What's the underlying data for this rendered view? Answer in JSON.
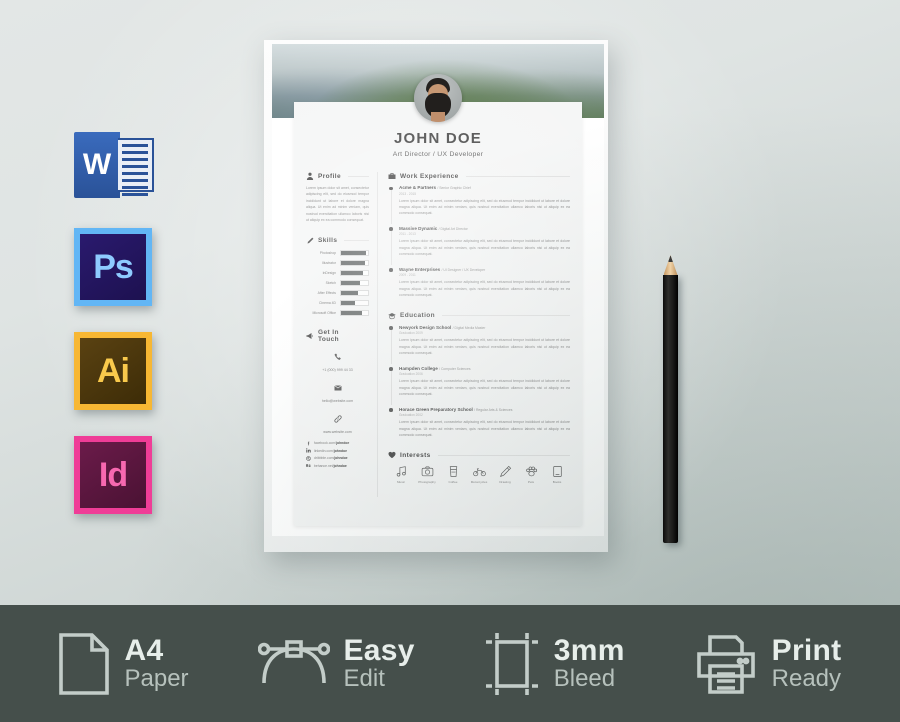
{
  "software_badges": [
    {
      "name": "Microsoft Word",
      "letters": "W",
      "icon": "word-icon"
    },
    {
      "name": "Adobe Photoshop",
      "letters": "Ps",
      "icon": "photoshop-icon"
    },
    {
      "name": "Adobe Illustrator",
      "letters": "Ai",
      "icon": "illustrator-icon"
    },
    {
      "name": "Adobe InDesign",
      "letters": "Id",
      "icon": "indesign-icon"
    }
  ],
  "resume": {
    "name": "JOHN DOE",
    "role": "Art Director / UX Developer",
    "profile": {
      "title": "Profile",
      "icon": "user-icon",
      "text": "Lorem ipsum dolor sit amet, consectetur adipiscing elit, sed do eiusmod tempor incididunt ut labore et dolore magna aliqua. Ut enim ad minim veniam, quis nostrud exercitation ullamco laboris nisi ut aliquip ex ea commodo consequat."
    },
    "skills": {
      "title": "Skills",
      "icon": "pen-icon",
      "items": [
        {
          "label": "Photoshop",
          "value": 92
        },
        {
          "label": "Illustrator",
          "value": 88
        },
        {
          "label": "InDesign",
          "value": 80
        },
        {
          "label": "Sketch",
          "value": 70
        },
        {
          "label": "After Effects",
          "value": 64
        },
        {
          "label": "Cinema 4D",
          "value": 51
        },
        {
          "label": "Microsoft Office",
          "value": 76
        }
      ]
    },
    "contact": {
      "title": "Get In Touch",
      "icon": "megaphone-icon",
      "phone": {
        "icon": "phone-icon",
        "value": "+1 (000) 999 44 33"
      },
      "email": {
        "icon": "mail-icon",
        "value": "hello@website.com"
      },
      "website": {
        "icon": "link-icon",
        "value": "www.website.com"
      },
      "social": [
        {
          "icon": "facebook-icon",
          "prefix": "facebook.com/",
          "handle": "johndoe"
        },
        {
          "icon": "linkedin-icon",
          "prefix": "linkedin.com/",
          "handle": "johndoe"
        },
        {
          "icon": "dribbble-icon",
          "prefix": "dribbble.com/",
          "handle": "johndoe"
        },
        {
          "icon": "behance-icon",
          "prefix": "behance.net/",
          "handle": "johndoe"
        }
      ]
    },
    "work": {
      "title": "Work Experience",
      "icon": "briefcase-icon",
      "entries": [
        {
          "company": "Acme & Partners",
          "position": "Senior Graphic Chief",
          "date": "2013 - 2015",
          "text": "Lorem ipsum dolor sit amet, consectetur adipiscing elit, sed do eiusmod tempor incididunt ut labore et dolore magna aliqua. Ut enim ad minim veniam, quis nostrud exercitation ullamco laboris nisi ut aliquip ex ea commodo consequat."
        },
        {
          "company": "Massive Dynamic",
          "position": "Digital Art Director",
          "date": "2011 - 2013",
          "text": "Lorem ipsum dolor sit amet, consectetur adipiscing elit, sed do eiusmod tempor incididunt ut labore et dolore magna aliqua. Ut enim ad minim veniam, quis nostrud exercitation ullamco laboris nisi ut aliquip ex ea commodo consequat."
        },
        {
          "company": "Wayne Enterprises",
          "position": "UI Designer / UX Developer",
          "date": "2009 - 2011",
          "text": "Lorem ipsum dolor sit amet, consectetur adipiscing elit, sed do eiusmod tempor incididunt ut labore et dolore magna aliqua. Ut enim ad minim veniam, quis nostrud exercitation ullamco laboris nisi ut aliquip ex ea commodo consequat."
        }
      ]
    },
    "education": {
      "title": "Education",
      "icon": "graduation-cap-icon",
      "entries": [
        {
          "school": "Newyork Design School",
          "degree": "Digital Media Master",
          "date": "Graduation 2009",
          "text": "Lorem ipsum dolor sit amet, consectetur adipiscing elit, sed do eiusmod tempor incididunt ut labore et dolore magna aliqua. Ut enim ad minim veniam, quis nostrud exercitation ullamco laboris nisi ut aliquip ex ea commodo consequat."
        },
        {
          "school": "Hampden College",
          "degree": "Computer Sciences",
          "date": "Graduation 2006",
          "text": "Lorem ipsum dolor sit amet, consectetur adipiscing elit, sed do eiusmod tempor incididunt ut labore et dolore magna aliqua. Ut enim ad minim veniam, quis nostrud exercitation ullamco laboris nisi ut aliquip ex ea commodo consequat."
        },
        {
          "school": "Horace Green Preparatory School",
          "degree": "Regular Arts & Sciences",
          "date": "Graduation 2002",
          "text": "Lorem ipsum dolor sit amet, consectetur adipiscing elit, sed do eiusmod tempor incididunt ut labore et dolore magna aliqua. Ut enim ad minim veniam, quis nostrud exercitation ullamco laboris nisi ut aliquip ex ea commodo consequat."
        }
      ]
    },
    "interests": {
      "title": "Interests",
      "icon": "heart-icon",
      "items": [
        {
          "label": "Music",
          "icon": "music-note-icon"
        },
        {
          "label": "Photography",
          "icon": "camera-icon"
        },
        {
          "label": "Coffee",
          "icon": "coffee-cup-icon"
        },
        {
          "label": "Motorcycles",
          "icon": "motorcycle-icon"
        },
        {
          "label": "Drawing",
          "icon": "pencil-icon"
        },
        {
          "label": "Pets",
          "icon": "paw-icon"
        },
        {
          "label": "Books",
          "icon": "book-icon"
        }
      ]
    }
  },
  "footer": {
    "features": [
      {
        "icon": "document-page-icon",
        "line1": "A4",
        "line2": "Paper"
      },
      {
        "icon": "bezier-curve-icon",
        "line1": "Easy",
        "line2": "Edit"
      },
      {
        "icon": "crop-marks-icon",
        "line1": "3mm",
        "line2": "Bleed"
      },
      {
        "icon": "printer-icon",
        "line1": "Print",
        "line2": "Ready"
      }
    ]
  },
  "colors": {
    "footer_bg": "#454f4b",
    "backdrop": "#d7dedd",
    "skill_fill": "#3f4444",
    "word_blue": "#2a5298",
    "photoshop_blue": "#62b6f5",
    "illustrator_orange": "#f7b733",
    "indesign_pink": "#ef3d97"
  }
}
